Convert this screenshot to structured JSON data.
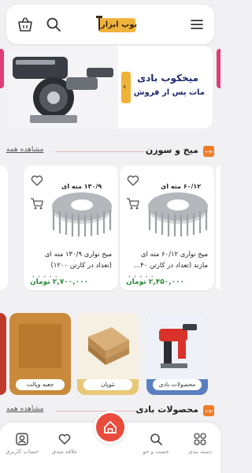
{
  "header": {
    "logo_text": "یوپ ابزار",
    "menu_icon": "hamburger-menu-icon",
    "search_icon": "search-icon",
    "basket_icon": "shopping-basket-icon"
  },
  "banner": {
    "title": "میخکوب بادی",
    "subtitle": "مات پس از فروش",
    "arrow": "‹"
  },
  "section_nails": {
    "title": "میخ و سوزن",
    "see_all": "مشاهده همه",
    "badge": "یوپ"
  },
  "products": [
    {
      "size_label": "۶۰/۱۲ مته ای",
      "name_line1": "میخ نواری ۶۰/۱۲ مته ای",
      "name_line2": "مازند (تعداد در کارتن ۴۰...",
      "price": "۲,۴۵۰,۰۰۰ تومان"
    },
    {
      "size_label": "۱۳۰/۹ مته ای",
      "name_line1": "میخ نواری ۱۳۰/۹ مته ای",
      "name_line2": "(تعداد در کارتن ۱۲۰۰)",
      "price": "۲,۷۰۰,۰۰۰ تومان"
    }
  ],
  "categories": [
    {
      "label": "محصولات بادی",
      "bg": "#5a7fc0"
    },
    {
      "label": "نئوپان",
      "bg": "#e8c878"
    },
    {
      "label": "جعبه وپالت",
      "bg": "#c98a3c"
    }
  ],
  "section_pneumatic": {
    "title": "محصولات بادی",
    "see_all": "مشاهده همه",
    "badge": "یوپ"
  },
  "tabbar": {
    "categories": "دسته بندی",
    "search": "جست و جو",
    "favorites": "علاقه مندی",
    "account": "حساب کاربری"
  },
  "colors": {
    "accent_orange": "#f07c28",
    "brand_gold": "#f0b33a",
    "price_green": "#2e8b3c",
    "home_red": "#e94b3c",
    "edge_pink": "#e03c78"
  }
}
